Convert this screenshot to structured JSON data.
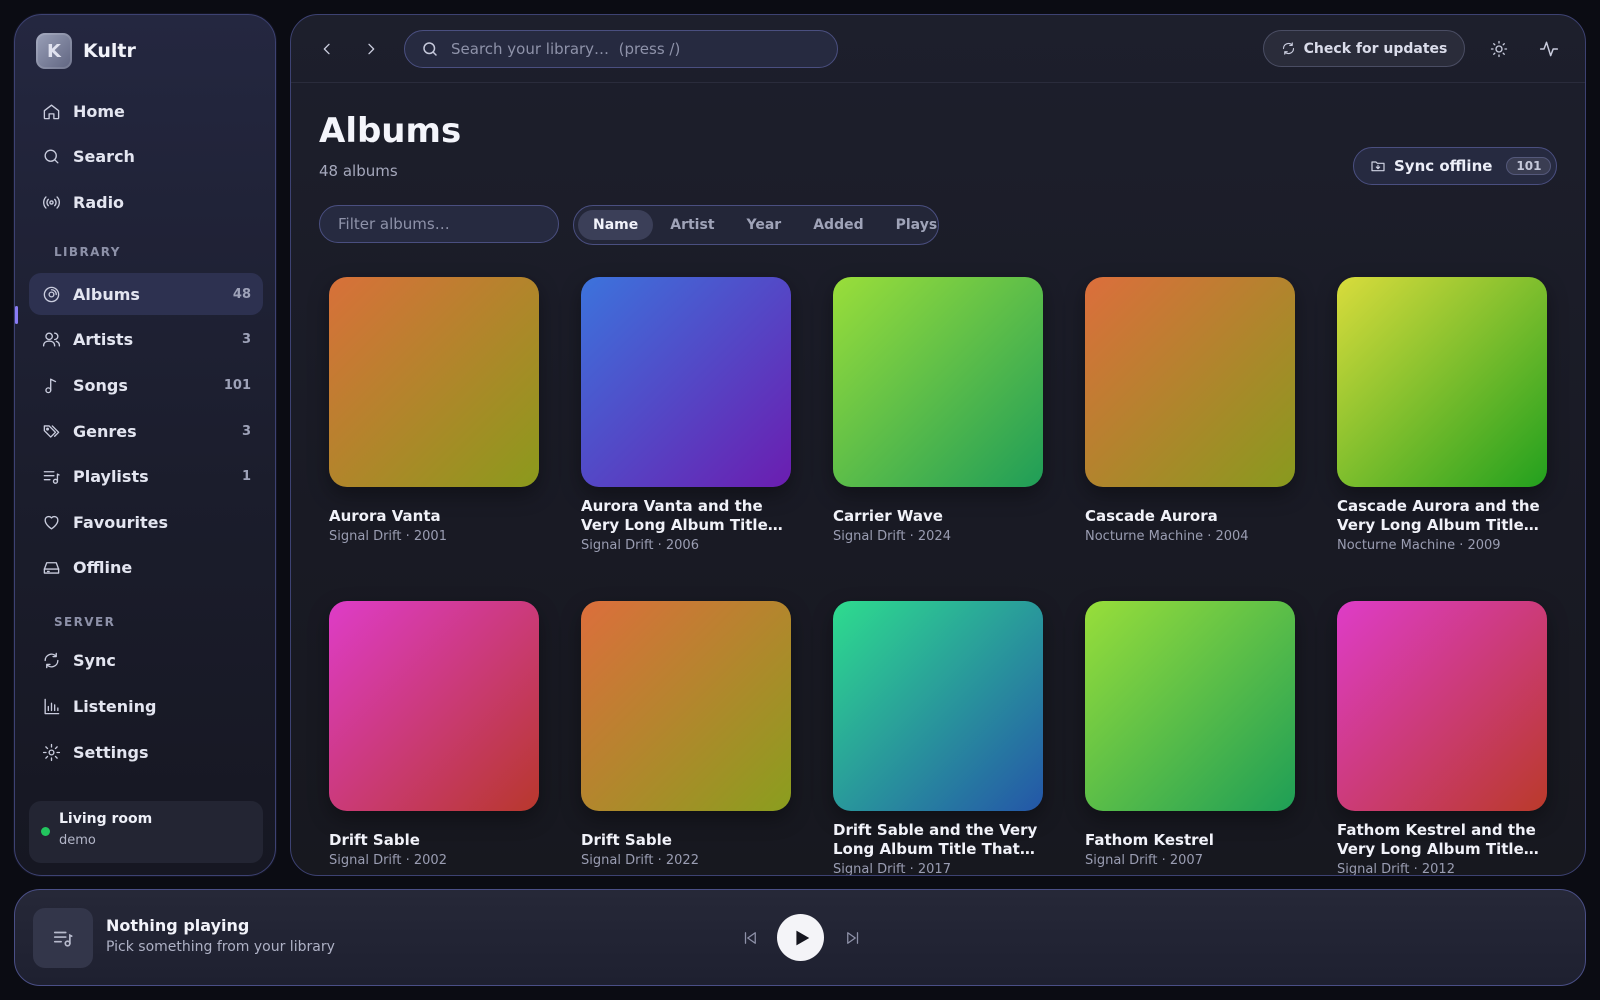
{
  "app": {
    "name": "Kultr"
  },
  "sidebar": {
    "nav": [
      {
        "label": "Home",
        "icon": "home-icon"
      },
      {
        "label": "Search",
        "icon": "search-icon"
      },
      {
        "label": "Radio",
        "icon": "radio-icon"
      }
    ],
    "library_label": "LIBRARY",
    "library": [
      {
        "label": "Albums",
        "count": "48",
        "icon": "album-icon",
        "active": true
      },
      {
        "label": "Artists",
        "count": "3",
        "icon": "users-icon"
      },
      {
        "label": "Songs",
        "count": "101",
        "icon": "music-note-icon"
      },
      {
        "label": "Genres",
        "count": "3",
        "icon": "tags-icon"
      },
      {
        "label": "Playlists",
        "count": "1",
        "icon": "playlist-icon"
      },
      {
        "label": "Favourites",
        "count": "",
        "icon": "heart-icon"
      },
      {
        "label": "Offline",
        "count": "",
        "icon": "drive-icon"
      }
    ],
    "server_label": "SERVER",
    "server": [
      {
        "label": "Sync",
        "icon": "sync-icon"
      },
      {
        "label": "Listening",
        "icon": "bar-chart-icon"
      },
      {
        "label": "Settings",
        "icon": "gear-icon"
      }
    ],
    "device": {
      "name": "Living room",
      "user": "demo",
      "status_color": "#22c55e"
    }
  },
  "topbar": {
    "search_placeholder": "Search your library…  (press /)",
    "check_updates": "Check for updates"
  },
  "page": {
    "title": "Albums",
    "subtitle": "48 albums",
    "sync_offline": "Sync offline",
    "sync_count": "101",
    "filter_placeholder": "Filter albums…",
    "sort_options": [
      "Name",
      "Artist",
      "Year",
      "Added",
      "Plays"
    ],
    "sort_selected": "Name"
  },
  "albums": [
    {
      "title": "Aurora Vanta",
      "meta": "Signal Drift · 2001",
      "colors": [
        "#d8703a",
        "#8b9a1c"
      ]
    },
    {
      "title": "Aurora Vanta and the Very Long Album Title That Keeps Going",
      "meta": "Signal Drift · 2006",
      "colors": [
        "#3c73dc",
        "#6b1db0"
      ]
    },
    {
      "title": "Carrier Wave",
      "meta": "Signal Drift · 2024",
      "colors": [
        "#9ade3a",
        "#1f9d58"
      ]
    },
    {
      "title": "Cascade Aurora",
      "meta": "Nocturne Machine · 2004",
      "colors": [
        "#dc6e3c",
        "#889a1e"
      ]
    },
    {
      "title": "Cascade Aurora and the Very Long Album Title That Keeps Going",
      "meta": "Nocturne Machine · 2009",
      "colors": [
        "#d9dc3c",
        "#22a01e"
      ]
    },
    {
      "title": "Drift Sable",
      "meta": "Signal Drift · 2002",
      "colors": [
        "#de3cc8",
        "#b8382c"
      ]
    },
    {
      "title": "Drift Sable",
      "meta": "Signal Drift · 2022",
      "colors": [
        "#dc6e3c",
        "#8a9e1e"
      ]
    },
    {
      "title": "Drift Sable and the Very Long Album Title That Keeps Going",
      "meta": "Signal Drift · 2017",
      "colors": [
        "#2edc8e",
        "#2456a8"
      ]
    },
    {
      "title": "Fathom Kestrel",
      "meta": "Signal Drift · 2007",
      "colors": [
        "#98de3a",
        "#1e9e56"
      ]
    },
    {
      "title": "Fathom Kestrel and the Very Long Album Title That Keeps Going",
      "meta": "Signal Drift · 2012",
      "colors": [
        "#de3cc8",
        "#ba3a2a"
      ]
    }
  ],
  "player": {
    "title": "Nothing playing",
    "subtitle": "Pick something from your library"
  }
}
